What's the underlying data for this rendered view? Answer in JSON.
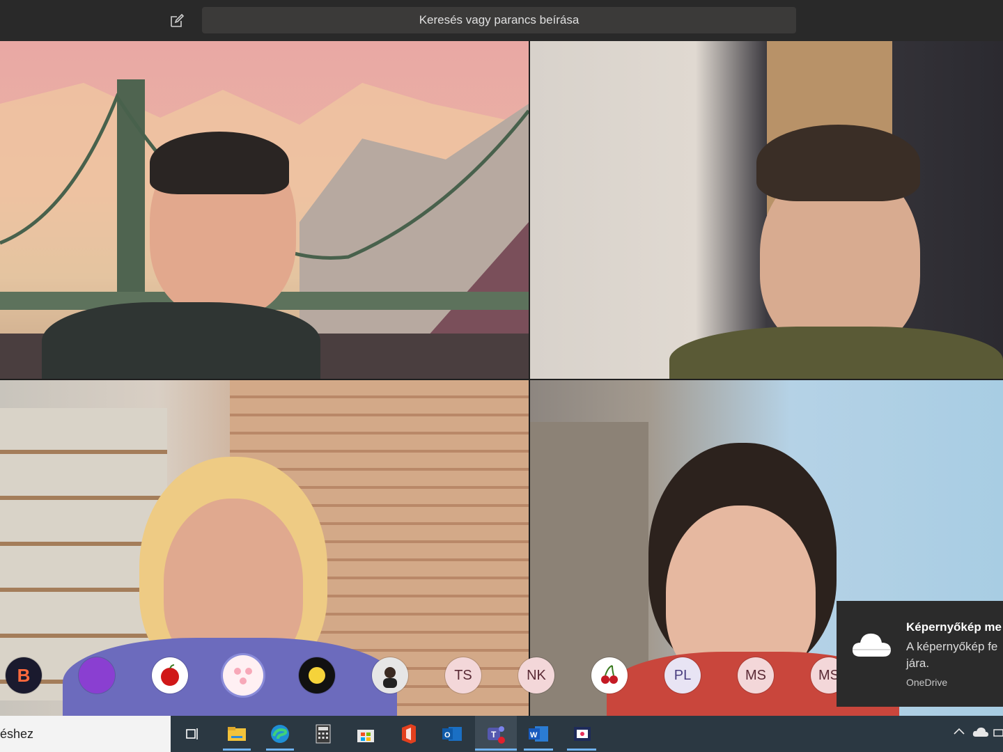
{
  "header": {
    "search_placeholder": "Keresés vagy parancs beírása"
  },
  "participants": [
    "TS",
    "NK",
    "PL",
    "MS",
    "MS"
  ],
  "toast": {
    "title": "Képernyőkép me",
    "body": "A képernyőkép fe jára.",
    "source": "OneDrive"
  },
  "taskbar": {
    "search_text": "éshez"
  },
  "colors": {
    "avatar_bg": "#f3d7d9",
    "avatar_text": "#5a2a35",
    "taskbar": "#2b3842",
    "accent": "#6fb2f0"
  }
}
